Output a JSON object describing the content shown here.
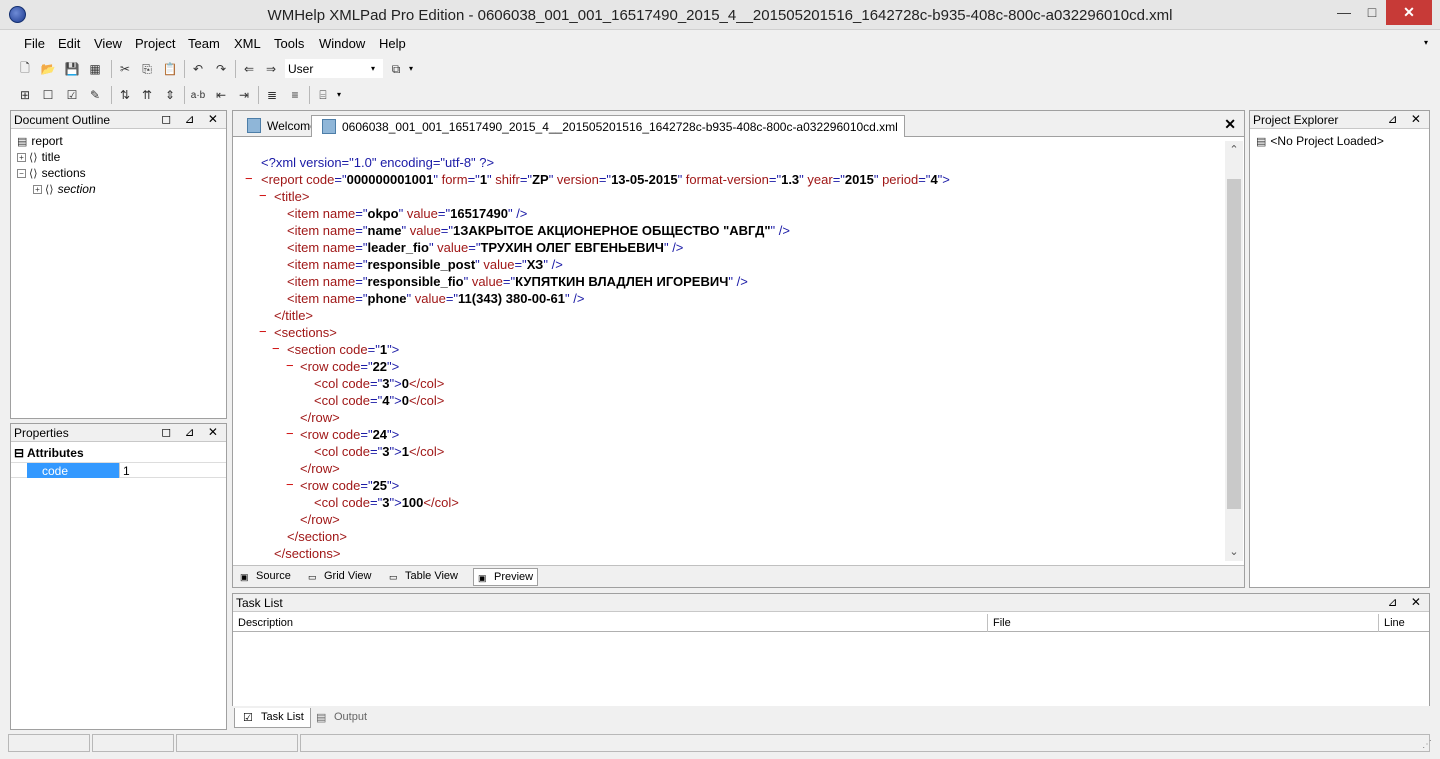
{
  "window": {
    "title": "WMHelp XMLPad Pro Edition - 0606038_001_001_16517490_2015_4__201505201516_1642728c-b935-408c-800c-a032296010cd.xml",
    "minimize_glyph": "—",
    "maximize_glyph": "□",
    "close_glyph": "✕"
  },
  "menu": {
    "items": [
      "File",
      "Edit",
      "View",
      "Project",
      "Team",
      "XML",
      "Tools",
      "Window",
      "Help"
    ],
    "overflow_glyph": "▾"
  },
  "toolbar": {
    "user_combo": "User",
    "combo_arrow": "▾"
  },
  "document_outline": {
    "title": "Document Outline",
    "head_buttons": "◻ ⊿ ✕",
    "nodes": [
      {
        "label": "report",
        "icon": "▤",
        "exp": ""
      },
      {
        "label": "title",
        "icon": "⟨⟩",
        "exp": "+"
      },
      {
        "label": "sections",
        "icon": "⟨⟩",
        "exp": "−"
      },
      {
        "label": "section",
        "icon": "⟨⟩",
        "exp": "+"
      }
    ]
  },
  "properties": {
    "title": "Properties",
    "head_buttons": "◻ ⊿ ✕",
    "group_toggle": "⊟",
    "group": "Attributes",
    "rows": [
      {
        "name": "code",
        "value": "1"
      }
    ]
  },
  "editor": {
    "tabs": [
      {
        "label": "Welcome"
      },
      {
        "label": "0606038_001_001_16517490_2015_4__201505201516_1642728c-b935-408c-800c-a032296010cd.xml"
      }
    ],
    "close_glyph": "✕",
    "scroll_up": "⌃",
    "scroll_down": "⌄",
    "collapse_marker": "−",
    "lines": {
      "l1": "<?xml version=\"1.0\" encoding=\"utf-8\" ?>",
      "l2_open": "<report ",
      "l2_a1": "code",
      "l2_v1": "000000001001",
      "l2_a2": "form",
      "l2_v2": "1",
      "l2_a3": "shifr",
      "l2_v3": "ZP",
      "l2_a4": "version",
      "l2_v4": "13-05-2015",
      "l2_a5": "format-version",
      "l2_v5": "1.3",
      "l2_a6": "year",
      "l2_v6": "2015",
      "l2_a7": "period",
      "l2_v7": "4",
      "title_open": "<title>",
      "item_tag": "<item ",
      "name_attr": "name",
      "value_attr": "value",
      "items": [
        {
          "name": "okpo",
          "value": "16517490"
        },
        {
          "name": "name",
          "value": "1ЗАКРЫТОЕ АКЦИОНЕРНОЕ ОБЩЕСТВО \"АВГД\""
        },
        {
          "name": "leader_fio",
          "value": "ТРУХИН ОЛЕГ ЕВГЕНЬЕВИЧ"
        },
        {
          "name": "responsible_post",
          "value": "ХЗ"
        },
        {
          "name": "responsible_fio",
          "value": "КУПЯТКИН ВЛАДЛЕН ИГОРЕВИЧ"
        },
        {
          "name": "phone",
          "value": "11(343) 380-00-61"
        }
      ],
      "item_close": " />",
      "title_close": "</title>",
      "sections_open": "<sections>",
      "section_open": "<section ",
      "code_attr": "code",
      "section_code": "1",
      "row_open": "<row ",
      "col_open": "<col ",
      "col_close": "</col>",
      "row_close": "</row>",
      "section_close": "</section>",
      "sections_close": "</sections>",
      "rows": [
        {
          "code": "22",
          "cols": [
            {
              "code": "3",
              "val": "0"
            },
            {
              "code": "4",
              "val": "0"
            }
          ]
        },
        {
          "code": "24",
          "cols": [
            {
              "code": "3",
              "val": "1"
            }
          ]
        },
        {
          "code": "25",
          "cols": [
            {
              "code": "3",
              "val": "100"
            }
          ]
        }
      ]
    },
    "view_tabs": [
      {
        "label": "Source",
        "icon": "▣"
      },
      {
        "label": "Grid View",
        "icon": "▭"
      },
      {
        "label": "Table View",
        "icon": "▭"
      },
      {
        "label": "Preview",
        "icon": "▣"
      }
    ]
  },
  "project_explorer": {
    "title": "Project Explorer",
    "head_buttons": "⊿ ✕",
    "empty_text": "<No Project Loaded>"
  },
  "task_list": {
    "title": "Task List",
    "head_buttons": "⊿ ✕",
    "columns": [
      "Description",
      "File",
      "Line"
    ]
  },
  "bottom_tabs": [
    {
      "label": "Task List",
      "icon": "☑"
    },
    {
      "label": "Output",
      "icon": "▤"
    }
  ],
  "status": {
    "grip": "⋰"
  }
}
